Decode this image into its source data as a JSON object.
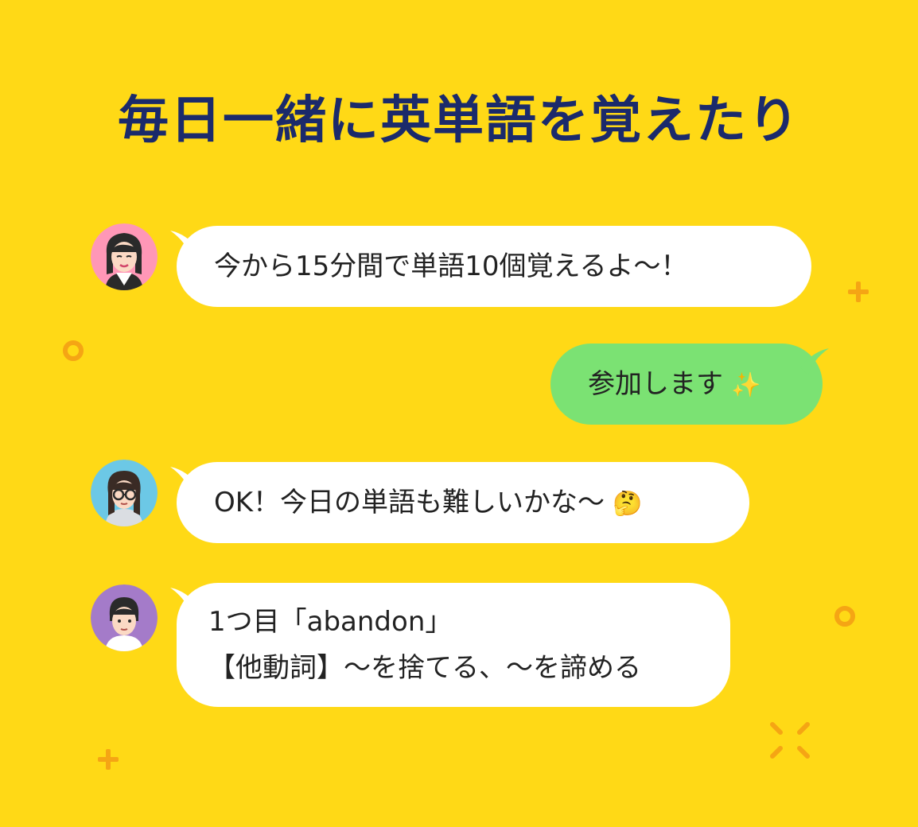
{
  "title": "毎日一緒に英単語を覚えたり",
  "messages": [
    {
      "side": "left",
      "avatar": "avatar-pink",
      "text": "今から15分間で単語10個覚えるよ〜！"
    },
    {
      "side": "right",
      "text": "参加します",
      "emoji": "✨",
      "emoji_name": "sparkles-icon"
    },
    {
      "side": "left",
      "avatar": "avatar-blue",
      "text": "OK！今日の単語も難しいかな〜",
      "emoji": "🤔",
      "emoji_name": "thinking-face-icon"
    },
    {
      "side": "left",
      "avatar": "avatar-purple",
      "lines": [
        "1つ目「abandon」",
        "【他動詞】〜を捨てる、〜を諦める"
      ]
    }
  ],
  "colors": {
    "background": "#FFD916",
    "title": "#1B2A6B",
    "bubble_white": "#FFFFFF",
    "bubble_green": "#7BE273",
    "decoration": "#F5A514"
  },
  "decorations": [
    "plus-icon",
    "ring-icon",
    "ring-icon",
    "plus-icon",
    "sparkle-burst-icon"
  ]
}
